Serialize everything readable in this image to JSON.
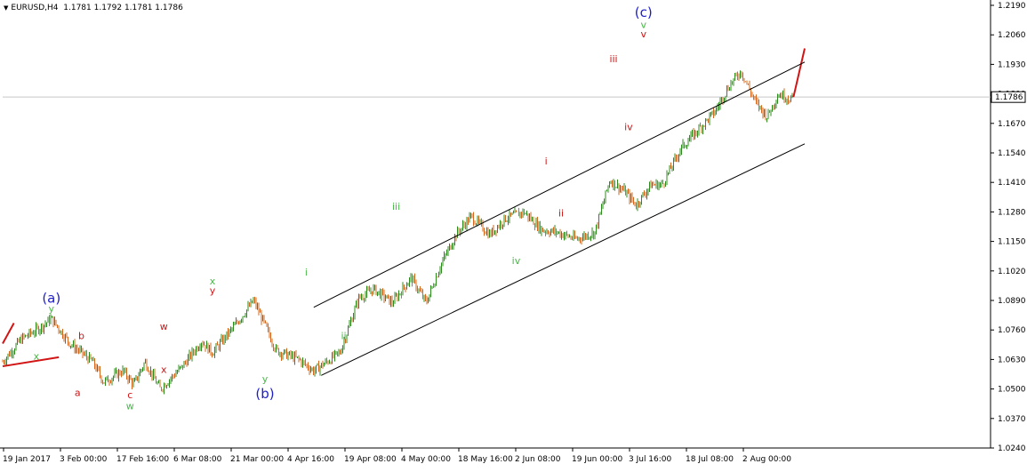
{
  "header": {
    "symbol_tf": "EURUSD,H4",
    "ohlc": "1.1781 1.1792 1.1781 1.1786"
  },
  "colors": {
    "bull": "#2e8b1e",
    "bear": "#d2691e",
    "wave_red": "#d21414",
    "wave_green": "#46b946",
    "wave_blue": "#1e1ec8",
    "channel": "#000000",
    "axis": "#000000",
    "price_marker_bg": "#ffffff"
  },
  "icons": {
    "header_arrow": "triangle-down-icon"
  },
  "chart_data": {
    "type": "candlestick",
    "price_axis": {
      "range": [
        1.024,
        1.219
      ],
      "ticks": [
        "1.2190",
        "1.2060",
        "1.1930",
        "1.1800",
        "1.1670",
        "1.1540",
        "1.1410",
        "1.1280",
        "1.1150",
        "1.1020",
        "1.0890",
        "1.0760",
        "1.0630",
        "1.0500",
        "1.0370",
        "1.0240"
      ],
      "current_price": "1.1786"
    },
    "time_axis": {
      "labels": [
        "19 Jan 2017",
        "3 Feb 00:00",
        "17 Feb 16:00",
        "6 Mar 08:00",
        "21 Mar 00:00",
        "4 Apr 16:00",
        "19 Apr 08:00",
        "4 May 00:00",
        "18 May 16:00",
        "2 Jun 08:00",
        "19 Jun 00:00",
        "3 Jul 16:00",
        "18 Jul 08:00",
        "2 Aug 00:00"
      ]
    },
    "price_path": [
      [
        "19 Jan",
        1.062
      ],
      [
        "24 Jan",
        1.072
      ],
      [
        "29 Jan",
        1.077
      ],
      [
        "1 Feb",
        1.081
      ],
      [
        "6 Feb",
        1.07
      ],
      [
        "12 Feb",
        1.062
      ],
      [
        "15 Feb",
        1.053
      ],
      [
        "20 Feb",
        1.058
      ],
      [
        "23 Feb",
        1.052
      ],
      [
        "26 Feb",
        1.062
      ],
      [
        "2 Mar",
        1.05
      ],
      [
        "8 Mar",
        1.06
      ],
      [
        "13 Mar",
        1.071
      ],
      [
        "16 Mar",
        1.066
      ],
      [
        "22 Mar",
        1.078
      ],
      [
        "27 Mar",
        1.089
      ],
      [
        "2 Apr",
        1.067
      ],
      [
        "8 Apr",
        1.063
      ],
      [
        "12 Apr",
        1.058
      ],
      [
        "19 Apr",
        1.066
      ],
      [
        "24 Apr",
        1.09
      ],
      [
        "28 Apr",
        1.094
      ],
      [
        "3 May",
        1.088
      ],
      [
        "8 May",
        1.099
      ],
      [
        "12 May",
        1.088
      ],
      [
        "16 May",
        1.105
      ],
      [
        "20 May",
        1.118
      ],
      [
        "24 May",
        1.126
      ],
      [
        "29 May",
        1.118
      ],
      [
        "2 Jun",
        1.125
      ],
      [
        "7 Jun",
        1.128
      ],
      [
        "12 Jun",
        1.12
      ],
      [
        "16 Jun",
        1.119
      ],
      [
        "21 Jun",
        1.116
      ],
      [
        "26 Jun",
        1.119
      ],
      [
        "30 Jun",
        1.142
      ],
      [
        "4 Jul",
        1.137
      ],
      [
        "7 Jul",
        1.131
      ],
      [
        "11 Jul",
        1.14
      ],
      [
        "14 Jul",
        1.14
      ],
      [
        "19 Jul",
        1.156
      ],
      [
        "24 Jul",
        1.165
      ],
      [
        "28 Jul",
        1.172
      ],
      [
        "1 Aug",
        1.184
      ],
      [
        "4 Aug",
        1.19
      ],
      [
        "8 Aug",
        1.176
      ],
      [
        "11 Aug",
        1.17
      ],
      [
        "14 Aug",
        1.18
      ],
      [
        "17 Aug",
        1.178
      ],
      [
        "18 Aug",
        1.1786
      ]
    ],
    "projection": [
      [
        "18 Aug",
        1.1786
      ],
      [
        "21 Aug",
        1.2
      ]
    ],
    "channel_lines": [
      {
        "name": "upper",
        "from": [
          "12 Apr",
          1.086
        ],
        "to": [
          "21 Aug",
          1.194
        ]
      },
      {
        "name": "lower",
        "from": [
          "14 Apr",
          1.056
        ],
        "to": [
          "21 Aug",
          1.158
        ]
      },
      {
        "name": "triangle-top",
        "from": [
          "19 Jan",
          1.07
        ],
        "to": [
          "22 Jan",
          1.079
        ]
      },
      {
        "name": "triangle-bottom",
        "from": [
          "19 Jan",
          1.06
        ],
        "to": [
          "3 Feb",
          1.064
        ]
      }
    ],
    "wave_labels": [
      {
        "text": "(a)",
        "at": [
          "1 Feb",
          1.088
        ],
        "color": "wave_blue",
        "size": "large"
      },
      {
        "text": "y",
        "at": [
          "1 Feb",
          1.084
        ],
        "color": "wave_green",
        "size": "small"
      },
      {
        "text": "x",
        "at": [
          "28 Jan",
          1.063
        ],
        "color": "wave_green",
        "size": "small"
      },
      {
        "text": "b",
        "at": [
          "9 Feb",
          1.072
        ],
        "color": "wave_red",
        "size": "small"
      },
      {
        "text": "a",
        "at": [
          "8 Feb",
          1.047
        ],
        "color": "wave_red",
        "size": "small"
      },
      {
        "text": "c",
        "at": [
          "22 Feb",
          1.046
        ],
        "color": "wave_red",
        "size": "small"
      },
      {
        "text": "w",
        "at": [
          "22 Feb",
          1.041
        ],
        "color": "wave_green",
        "size": "small"
      },
      {
        "text": "w",
        "at": [
          "3 Mar",
          1.076
        ],
        "color": "wave_red",
        "size": "small"
      },
      {
        "text": "x",
        "at": [
          "3 Mar",
          1.057
        ],
        "color": "wave_red",
        "size": "small"
      },
      {
        "text": "x",
        "at": [
          "16 Mar",
          1.096
        ],
        "color": "wave_green",
        "size": "small"
      },
      {
        "text": "y",
        "at": [
          "16 Mar",
          1.092
        ],
        "color": "wave_red",
        "size": "small"
      },
      {
        "text": "y",
        "at": [
          "30 Mar",
          1.053
        ],
        "color": "wave_green",
        "size": "small"
      },
      {
        "text": "(b)",
        "at": [
          "30 Mar",
          1.046
        ],
        "color": "wave_blue",
        "size": "large"
      },
      {
        "text": "i",
        "at": [
          "10 Apr",
          1.1
        ],
        "color": "wave_green",
        "size": "small"
      },
      {
        "text": "ii",
        "at": [
          "20 Apr",
          1.072
        ],
        "color": "wave_green",
        "size": "small"
      },
      {
        "text": "iii",
        "at": [
          "4 May",
          1.129
        ],
        "color": "wave_green",
        "size": "small"
      },
      {
        "text": "iv",
        "at": [
          "5 Jun",
          1.105
        ],
        "color": "wave_green",
        "size": "small"
      },
      {
        "text": "i",
        "at": [
          "13 Jun",
          1.149
        ],
        "color": "wave_red",
        "size": "small"
      },
      {
        "text": "ii",
        "at": [
          "17 Jun",
          1.126
        ],
        "color": "wave_red",
        "size": "small"
      },
      {
        "text": "iii",
        "at": [
          "1 Jul",
          1.194
        ],
        "color": "wave_red",
        "size": "small"
      },
      {
        "text": "iv",
        "at": [
          "5 Jul",
          1.164
        ],
        "color": "wave_red",
        "size": "small"
      },
      {
        "text": "v",
        "at": [
          "9 Jul",
          1.205
        ],
        "color": "wave_red",
        "size": "small"
      },
      {
        "text": "v",
        "at": [
          "9 Jul",
          1.209
        ],
        "color": "wave_green",
        "size": "small"
      },
      {
        "text": "(c)",
        "at": [
          "9 Jul",
          1.214
        ],
        "color": "wave_blue",
        "size": "large"
      }
    ]
  }
}
